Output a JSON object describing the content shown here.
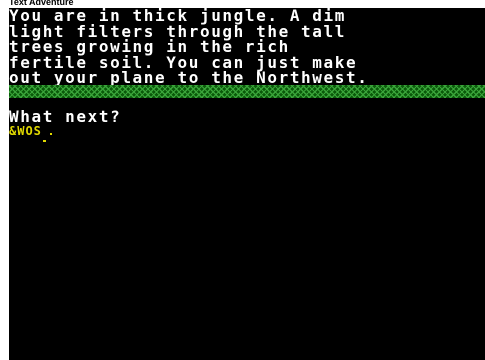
{
  "window": {
    "title": "Text Adventure"
  },
  "location_text": "You are in thick jungle. A dim\nlight filters through the tall\ntrees growing in the rich\nfertile soil. You can just make\nout your plane to the Northwest.",
  "prompt": "What next?",
  "input": {
    "value": "&WOS",
    "cursor_icon": "slash-cursor-icon"
  },
  "colors": {
    "background": "#000000",
    "text": "#ffffff",
    "input": "#e0d800",
    "divider": "#0a5a0a",
    "divider_pattern": "#3aa43a"
  }
}
